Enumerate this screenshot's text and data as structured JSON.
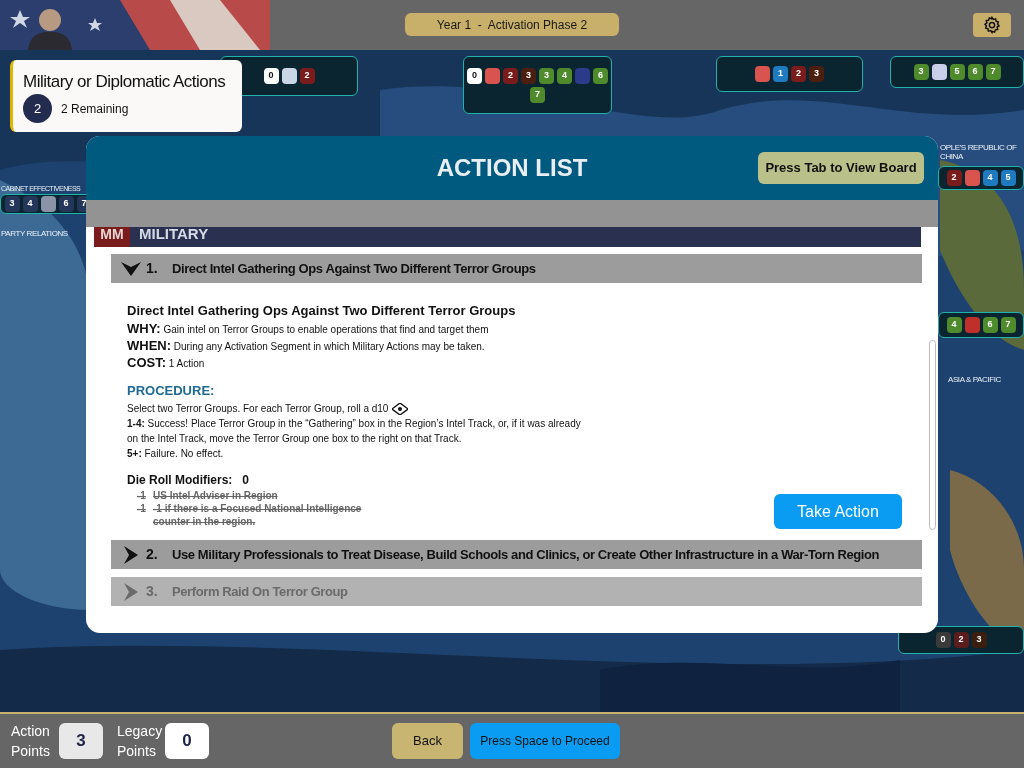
{
  "top_bar": {
    "phase": "Year 1  -  Activation Phase 2"
  },
  "action_card": {
    "title": "Military or Diplomatic Actions",
    "count": "2",
    "remaining": "2 Remaining"
  },
  "board": {
    "labels": [
      "CABINET EFFECTIVENESS",
      "PARTY RELATIONS",
      "OPLE'S REPUBLIC OF CHINA",
      "ASIA & PACIFIC"
    ],
    "panels": [
      {
        "tiles": [
          {
            "text": "0",
            "color": "#ffffff"
          },
          {
            "color": "#c9d6e6"
          },
          {
            "text": "2",
            "color": "#7a1c1c"
          }
        ]
      },
      {
        "tiles": [
          {
            "text": "0",
            "color": "#ffffff"
          },
          {
            "color": "#d9534f"
          },
          {
            "text": "2",
            "color": "#7a1c1c"
          },
          {
            "text": "3",
            "color": "#4a1f10"
          },
          {
            "text": "3",
            "color": "#4f8a2c"
          },
          {
            "text": "4",
            "color": "#4f8a2c"
          },
          {
            "color": "#2c3a8a"
          },
          {
            "text": "6",
            "color": "#4f8a2c"
          },
          {
            "text": "7",
            "color": "#4f8a2c"
          }
        ]
      },
      {
        "tiles": [
          {
            "color": "#d9534f"
          },
          {
            "text": "1",
            "color": "#1f7ac0"
          },
          {
            "text": "2",
            "color": "#7a1c1c"
          },
          {
            "text": "3",
            "color": "#4a1f10"
          }
        ]
      },
      {
        "tiles": [
          {
            "text": "3",
            "color": "#4f8a2c"
          },
          {
            "color": "#c8cfe8"
          },
          {
            "text": "5",
            "color": "#4f8a2c"
          },
          {
            "text": "6",
            "color": "#4f8a2c"
          },
          {
            "text": "7",
            "color": "#4f8a2c"
          }
        ]
      },
      {
        "tiles": [
          {
            "text": "3",
            "color": "#24365a"
          },
          {
            "text": "4",
            "color": "#24365a"
          },
          {
            "color": "#8a93a8"
          },
          {
            "text": "6",
            "color": "#24365a"
          },
          {
            "text": "7",
            "color": "#24365a"
          }
        ]
      },
      {
        "tiles": [
          {
            "text": "2",
            "color": "#7a1c1c"
          },
          {
            "color": "#d9534f"
          },
          {
            "text": "4",
            "color": "#1f7ac0"
          },
          {
            "text": "5",
            "color": "#1f7ac0"
          }
        ]
      },
      {
        "tiles": [
          {
            "text": "4",
            "color": "#4f8a2c"
          },
          {
            "color": "#c0302a"
          },
          {
            "text": "6",
            "color": "#4f8a2c"
          },
          {
            "text": "7",
            "color": "#4f8a2c"
          }
        ]
      },
      {
        "tiles": [
          {
            "text": "0",
            "color": "#3a3a3a"
          },
          {
            "text": "2",
            "color": "#5a1c1c"
          },
          {
            "text": "3",
            "color": "#3a1f10"
          }
        ]
      }
    ]
  },
  "modal": {
    "title": "ACTION LIST",
    "tab_button": "Press Tab to View Board",
    "section": {
      "code": "MM",
      "name": "MILITARY"
    },
    "actions": [
      {
        "number": "1.",
        "title": "Direct Intel Gathering Ops Against Two Different Terror Groups",
        "expanded": true,
        "disabled": false
      },
      {
        "number": "2.",
        "title": "Use Military Professionals to Treat Disease, Build Schools and Clinics, or Create Other Infrastructure in a War-Torn Region",
        "expanded": false,
        "disabled": false
      },
      {
        "number": "3.",
        "title": "Perform Raid On Terror Group",
        "expanded": false,
        "disabled": true
      }
    ],
    "detail": {
      "heading": "Direct Intel Gathering Ops Against Two Different Terror Groups",
      "facts": [
        "**WHY:** Gain intel on Terror Groups to enable operations that find and target them",
        "**WHEN:** During any Activation Segment in which Military Actions may be taken.",
        "**COST:** 1 Action"
      ],
      "procedure_label": "PROCEDURE:",
      "procedure_intro": "Select two Terror Groups. For each Terror Group, roll a d10",
      "procedure": [
        "**1-4:** Success! Place Terror Group in the “Gathering” box in the Region’s Intel Track, or, if it was already on the Intel Track, move the Terror Group one box to the right on that Track.",
        "**5+:** Failure. No effect."
      ],
      "modifiers_label": "Die Roll Modifiers:",
      "modifiers_total": "0",
      "modifiers": [
        {
          "value": "-1",
          "text": "US Intel Adviser in Region",
          "struck": true
        },
        {
          "value": "-1",
          "text": "-1 if there is a Focused National Intelligence counter in the region.",
          "struck": true
        }
      ],
      "take_action": "Take Action"
    }
  },
  "bottom_bar": {
    "action_points_label": "Action Points",
    "action_points": "3",
    "legacy_points_label": "Legacy Points",
    "legacy_points": "0",
    "back": "Back",
    "proceed": "Press Space to Proceed"
  }
}
